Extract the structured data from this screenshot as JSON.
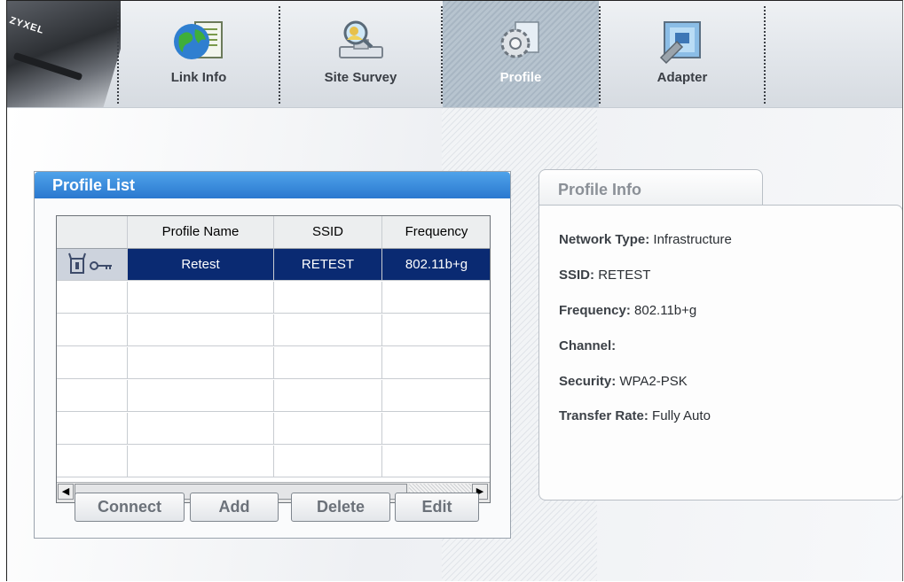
{
  "nav": {
    "brand": "ZYXEL",
    "tabs": [
      {
        "label": "Link Info",
        "icon": "globe-document-icon"
      },
      {
        "label": "Site Survey",
        "icon": "network-search-icon"
      },
      {
        "label": "Profile",
        "icon": "gear-document-icon",
        "active": true
      },
      {
        "label": "Adapter",
        "icon": "adapter-tools-icon"
      }
    ]
  },
  "profile_list": {
    "title": "Profile List",
    "columns": [
      "",
      "Profile Name",
      "SSID",
      "Frequency"
    ],
    "rows": [
      {
        "name": "Retest",
        "ssid": "RETEST",
        "frequency": "802.11b+g",
        "selected": true
      }
    ],
    "buttons": {
      "connect": "Connect",
      "add": "Add",
      "delete": "Delete",
      "edit": "Edit"
    }
  },
  "profile_info": {
    "title": "Profile Info",
    "fields": [
      {
        "label": "Network Type:",
        "value": "Infrastructure"
      },
      {
        "label": "SSID:",
        "value": "RETEST"
      },
      {
        "label": "Frequency:",
        "value": "802.11b+g"
      },
      {
        "label": "Channel:",
        "value": ""
      },
      {
        "label": "Security:",
        "value": "WPA2-PSK"
      },
      {
        "label": "Transfer Rate:",
        "value": "Fully Auto"
      }
    ]
  },
  "colors": {
    "selection": "#0a2a72",
    "header_blue": "#2a78cf",
    "active_tab": "#b0bdc9"
  }
}
